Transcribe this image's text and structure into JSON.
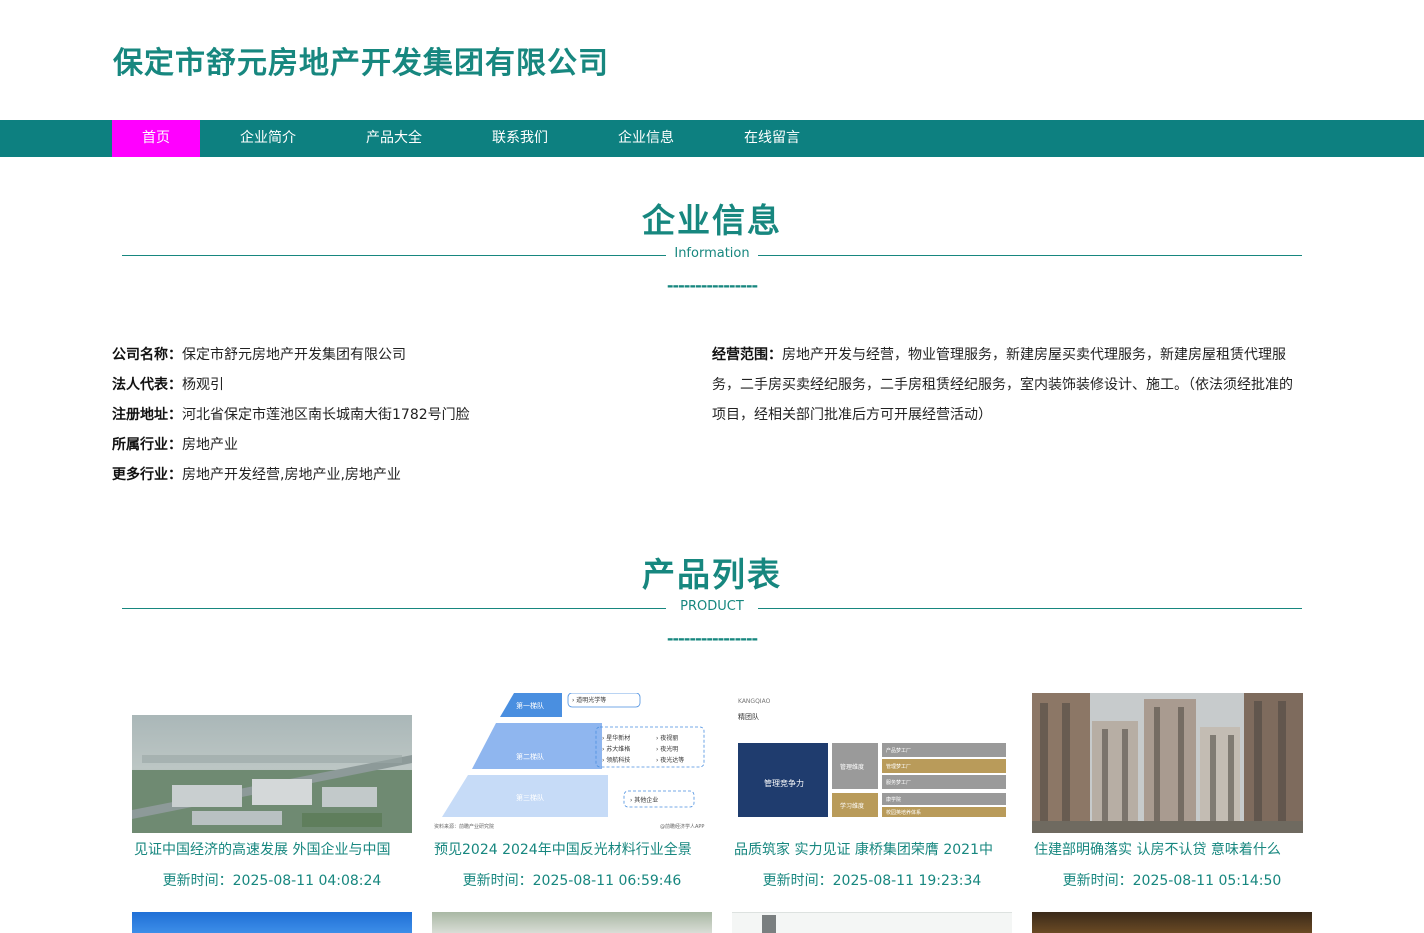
{
  "header": {
    "site_title": "保定市舒元房地产开发集团有限公司"
  },
  "nav": {
    "items": [
      {
        "label": "首页"
      },
      {
        "label": "企业简介"
      },
      {
        "label": "产品大全"
      },
      {
        "label": "联系我们"
      },
      {
        "label": "企业信息"
      },
      {
        "label": "在线留言"
      }
    ]
  },
  "company_section": {
    "title": "企业信息",
    "subtitle": "Information",
    "dashes": "----------------"
  },
  "company_info": {
    "name_key": "公司名称：",
    "name_value": "保定市舒元房地产开发集团有限公司",
    "legal_key": "法人代表：",
    "legal_value": "杨观引",
    "address_key": "注册地址：",
    "address_value": "河北省保定市莲池区南长城南大街1782号门脸",
    "industry_key": "所属行业：",
    "industry_value": "房地产业",
    "more_key": "更多行业：",
    "more_value": "房地产开发经营,房地产业,房地产业",
    "scope_key": "经营范围：",
    "scope_value": "房地产开发与经营，物业管理服务，新建房屋买卖代理服务，新建房屋租赁代理服务，二手房买卖经纪服务，二手房租赁经纪服务，室内装饰装修设计、施工。（依法须经批准的项目，经相关部门批准后方可开展经营活动）"
  },
  "product_section": {
    "title": "产品列表",
    "subtitle": "PRODUCT",
    "dashes": "----------------"
  },
  "products": [
    {
      "title": "见证中国经济的高速发展 外国企业与中国",
      "time": "更新时间：2025-08-11 04:08:24"
    },
    {
      "title": "预见2024 2024年中国反光材料行业全景",
      "time": "更新时间：2025-08-11 06:59:46"
    },
    {
      "title": "品质筑家 实力见证 康桥集团荣膺 2021中",
      "time": "更新时间：2025-08-11 19:23:34"
    },
    {
      "title": "住建部明确落实 认房不认贷 意味着什么",
      "time": "更新时间：2025-08-11 05:14:50"
    }
  ],
  "image_text": {
    "pyramid_tier1": "第一梯队",
    "pyramid_tier2": "第二梯队",
    "pyramid_tier3": "第三梯队",
    "pyramid_note1": "› 道明光学等",
    "pyramid_note3": "› 其他企业",
    "pyramid_list": [
      "› 星华新材",
      "› 夜视丽",
      "› 苏大维格",
      "› 夜光明",
      "› 领航科技",
      "› 夜光达等"
    ],
    "pyramid_source": "资料来源：前瞻产业研究院",
    "pyramid_brand": "@前瞻经济学人APP",
    "slide_brand": "KANGQIAO",
    "slide_heading": "精团队",
    "slide_main": "管理竞争力",
    "slide_mid1": "管理维度",
    "slide_mid2": "学习维度",
    "slide_items": [
      "产品梦工厂",
      "管理梦工厂",
      "服务梦工厂",
      "康学院",
      "校园英培养体系"
    ]
  },
  "colors": {
    "accent": "#17877f",
    "nav_bg": "#0d8080",
    "nav_active": "#ff00ff"
  }
}
